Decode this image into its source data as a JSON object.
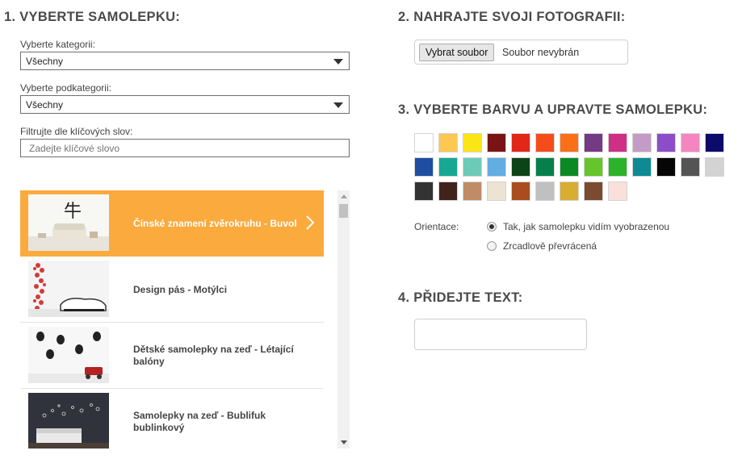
{
  "step1": {
    "title": "1. VYBERTE SAMOLEPKU:",
    "category_label": "Vyberte kategorii:",
    "category_value": "Všechny",
    "subcategory_label": "Vyberte podkategorii:",
    "subcategory_value": "Všechny",
    "keyword_label": "Filtrujte dle klíčových slov:",
    "keyword_placeholder": "Zadejte klíčové slovo",
    "items": [
      {
        "label": "Čínské znamení zvěrokruhu - Buvol",
        "selected": true
      },
      {
        "label": "Design pás - Motýlci",
        "selected": false
      },
      {
        "label": "Dětské samolepky na zeď - Létající balóny",
        "selected": false
      },
      {
        "label": "Samolepky na zeď - Bublifuk bublinkový",
        "selected": false
      }
    ],
    "selected_color": "#fbaa3d"
  },
  "step2": {
    "title": "2. NAHRAJTE SVOJI FOTOGRAFII:",
    "button_label": "Vybrat soubor",
    "file_status": "Soubor nevybrán"
  },
  "step3": {
    "title": "3. VYBERTE BARVU A UPRAVTE SAMOLEPKU:",
    "colors": [
      "#ffffff",
      "#fcc84f",
      "#fce514",
      "#7a1414",
      "#e22718",
      "#f44d1b",
      "#fb6f19",
      "#753a84",
      "#cf2f84",
      "#c39cc5",
      "#8b4ec8",
      "#f585c1",
      "#0c0a6a",
      "#1e4da1",
      "#17a894",
      "#6ccbb6",
      "#62ade2",
      "#0c4317",
      "#06804b",
      "#0a8a24",
      "#66c52b",
      "#2db22b",
      "#0d8a93",
      "#060606",
      "#545454",
      "#d3d3d3",
      "#333333",
      "#40231b",
      "#c08c68",
      "#ece3d2",
      "#a94d1e",
      "#c0c0c0",
      "#d7ad33",
      "#7a4b30",
      "#fadfda"
    ],
    "orientation_label": "Orientace:",
    "orientation_options": [
      {
        "label": "Tak, jak samolepku vidím vyobrazenou",
        "checked": true
      },
      {
        "label": "Zrcadlově převrácená",
        "checked": false
      }
    ]
  },
  "step4": {
    "title": "4. PŘIDEJTE TEXT:",
    "text_value": ""
  }
}
